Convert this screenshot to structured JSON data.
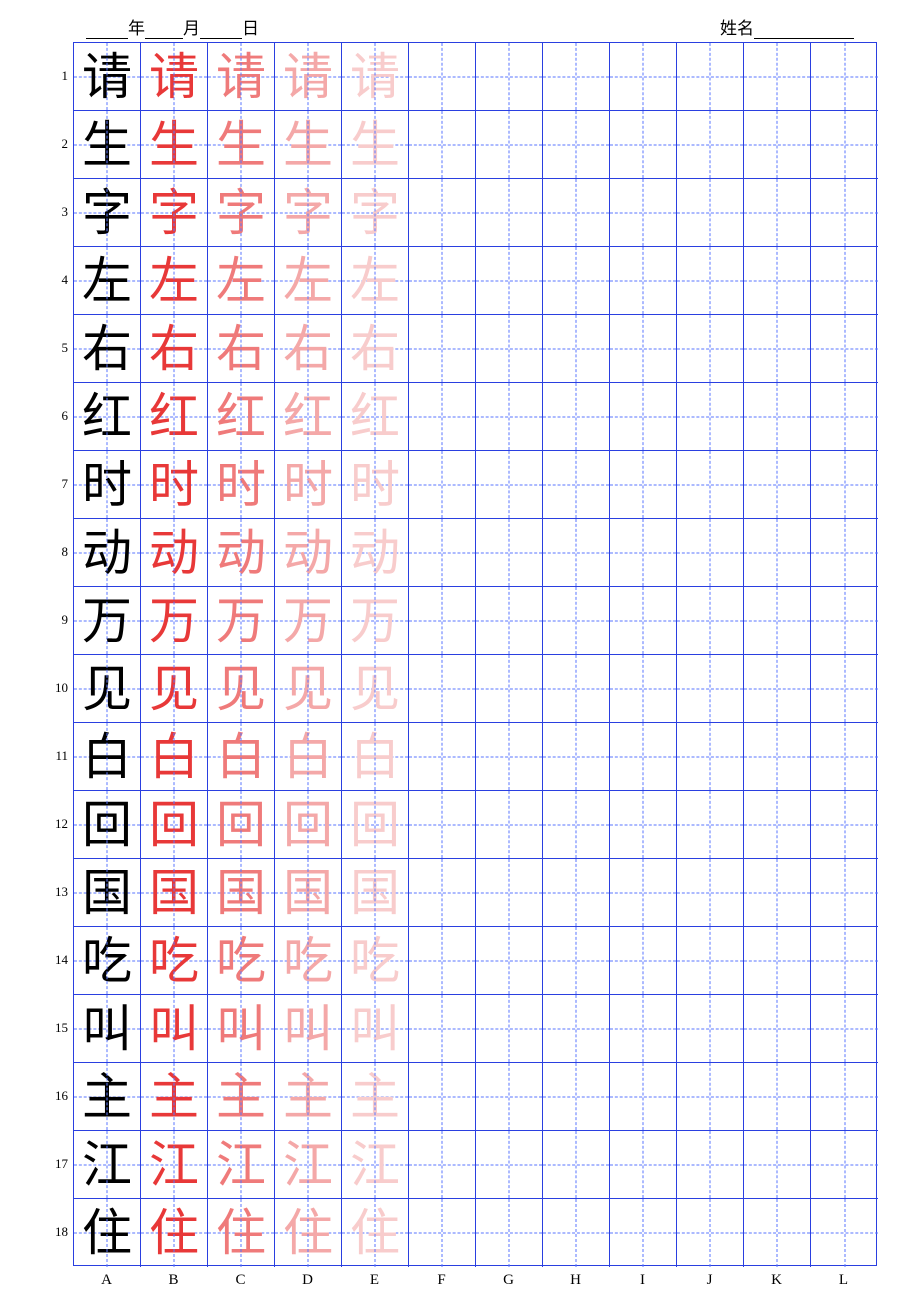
{
  "header": {
    "year_label": "年",
    "month_label": "月",
    "day_label": "日",
    "name_label": "姓名"
  },
  "grid": {
    "rows": 18,
    "cols": 12,
    "row_labels": [
      "1",
      "2",
      "3",
      "4",
      "5",
      "6",
      "7",
      "8",
      "9",
      "10",
      "11",
      "12",
      "13",
      "14",
      "15",
      "16",
      "17",
      "18"
    ],
    "col_labels": [
      "A",
      "B",
      "C",
      "D",
      "E",
      "F",
      "G",
      "H",
      "I",
      "J",
      "K",
      "L"
    ],
    "characters": [
      "请",
      "生",
      "字",
      "左",
      "右",
      "红",
      "时",
      "动",
      "万",
      "见",
      "白",
      "回",
      "国",
      "吃",
      "叫",
      "主",
      "江",
      "住"
    ],
    "fade_classes": [
      "c-black",
      "c-red1",
      "c-red2",
      "c-red3",
      "c-red4"
    ]
  }
}
